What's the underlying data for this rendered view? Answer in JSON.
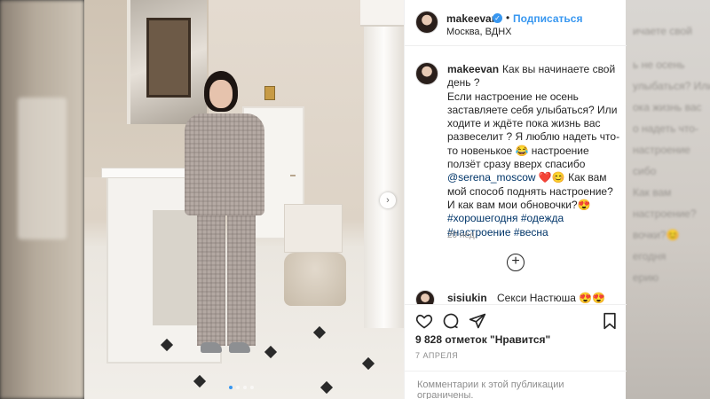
{
  "post": {
    "username": "makeevan",
    "follow_label": "Подписаться",
    "separator": "•",
    "location": "Москва, ВДНХ",
    "verified_glyph": "✓",
    "caption_lines": [
      "Как вы начинаете свой",
      "день ?",
      "Если настроение не осень",
      "заставляете себя улыбаться? Или",
      "ходите и ждёте пока жизнь вас",
      "развеселит ? Я люблю надеть что-",
      "то новенькое 😂 настроение",
      "ползёт сразу вверх спасибо"
    ],
    "mention": "@serena_moscow",
    "mention_suffix": " ❤️😊 Как вам",
    "caption_tail": [
      "мой способ поднять настроение?",
      "И как вам мои обновочки?😍"
    ],
    "hashtags_line1": "#хорошегодня #одежда",
    "hashtags_line2": "#настроение #весна",
    "time_ago": "20 нед.",
    "load_more_glyph": "+",
    "comment": {
      "username": "sisiukin",
      "text": "Секси Настюша 😍😍"
    },
    "likes": "9 828 отметок \"Нравится\"",
    "date": "7 АПРЕЛЯ",
    "comments_limited": "Комментарии к этой публикации ограничены."
  },
  "carousel": {
    "next_glyph": "›",
    "slide_count": 4,
    "active_slide": 1
  },
  "backdrop_blur_text": [
    "ичаете свой",
    "ь не осень",
    "улыбаться? Или",
    "ока жизнь вас",
    "о надеть что-",
    "настроение",
    "сибо",
    "Как вам",
    "настроение?",
    "вочки?😊",
    "егодня",
    "ерию"
  ],
  "colors": {
    "accent": "#3897f0",
    "link": "#003569"
  }
}
